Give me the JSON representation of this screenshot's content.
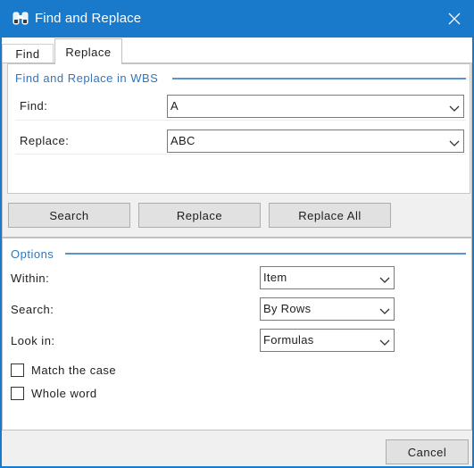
{
  "window": {
    "title": "Find and Replace",
    "close_label": "✕"
  },
  "tabs": [
    {
      "label": "Find",
      "selected": false
    },
    {
      "label": "Replace",
      "selected": true
    }
  ],
  "replace_group": {
    "title": "Find and Replace in WBS",
    "find_label": "Find:",
    "find_value": "A",
    "replace_label": "Replace:",
    "replace_value": "ABC"
  },
  "buttons": {
    "search": "Search",
    "replace": "Replace",
    "replace_all": "Replace All",
    "cancel": "Cancel"
  },
  "options": {
    "title": "Options",
    "within_label": "Within:",
    "within_value": "Item",
    "search_label": "Search:",
    "search_value": "By Rows",
    "lookin_label": "Look in:",
    "lookin_value": "Formulas",
    "match_case_label": "Match the case",
    "match_case_checked": false,
    "whole_word_label": "Whole word",
    "whole_word_checked": false
  },
  "colors": {
    "titlebar": "#1979ca",
    "accent_text": "#2f76c0",
    "accent_line": "#5a93cf"
  },
  "icons": {
    "app": "binoculars-icon",
    "close": "close-icon",
    "dropdown": "chevron-down-icon"
  }
}
